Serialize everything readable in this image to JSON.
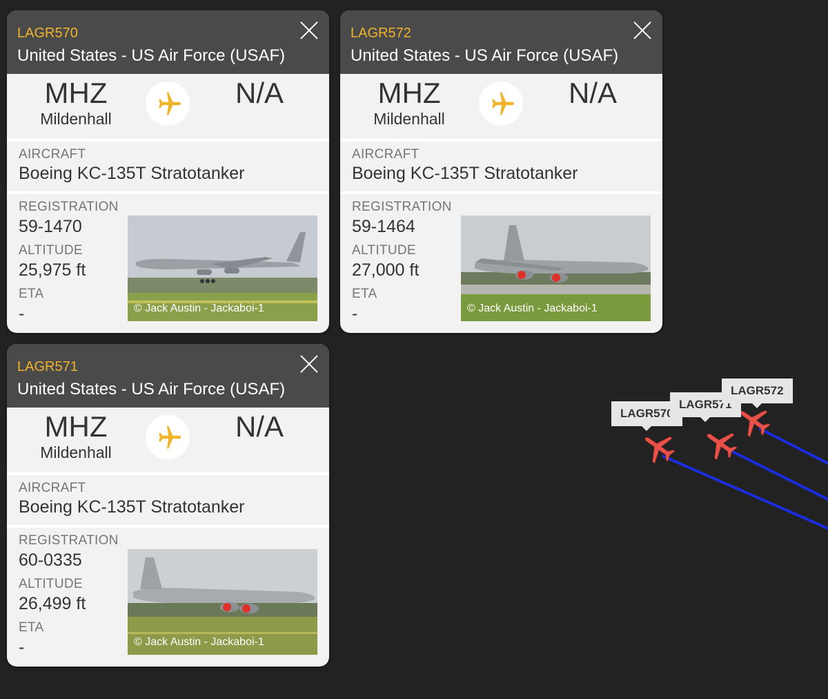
{
  "panels": [
    {
      "callsign": "LAGR570",
      "operator": "United States - US Air Force (USAF)",
      "origin_code": "MHZ",
      "origin_name": "Mildenhall",
      "destination_code": "N/A",
      "aircraft_label": "AIRCRAFT",
      "aircraft": "Boeing KC-135T Stratotanker",
      "registration_label": "REGISTRATION",
      "registration": "59-1470",
      "altitude_label": "ALTITUDE",
      "altitude": "25,975 ft",
      "eta_label": "ETA",
      "eta": "-",
      "photo_credit": "© Jack Austin - Jackaboi-1"
    },
    {
      "callsign": "LAGR572",
      "operator": "United States - US Air Force (USAF)",
      "origin_code": "MHZ",
      "origin_name": "Mildenhall",
      "destination_code": "N/A",
      "aircraft_label": "AIRCRAFT",
      "aircraft": "Boeing KC-135T Stratotanker",
      "registration_label": "REGISTRATION",
      "registration": "59-1464",
      "altitude_label": "ALTITUDE",
      "altitude": "27,000 ft",
      "eta_label": "ETA",
      "eta": "-",
      "photo_credit": "© Jack Austin - Jackaboi-1"
    },
    {
      "callsign": "LAGR571",
      "operator": "United States - US Air Force (USAF)",
      "origin_code": "MHZ",
      "origin_name": "Mildenhall",
      "destination_code": "N/A",
      "aircraft_label": "AIRCRAFT",
      "aircraft": "Boeing KC-135T Stratotanker",
      "registration_label": "REGISTRATION",
      "registration": "60-0335",
      "altitude_label": "ALTITUDE",
      "altitude": "26,499 ft",
      "eta_label": "ETA",
      "eta": "-",
      "photo_credit": "© Jack Austin - Jackaboi-1"
    }
  ],
  "map": {
    "labels": [
      "LAGR570",
      "LAGR571",
      "LAGR572"
    ],
    "track_color": "#1a2ee0",
    "aircraft_color": "#e8504a"
  },
  "colors": {
    "background": "#222222",
    "header": "#4a4a4a",
    "callsign": "#f0b429",
    "plane_icon": "#f0b429"
  },
  "icons": {
    "close": "close-icon",
    "route": "airplane-icon"
  }
}
